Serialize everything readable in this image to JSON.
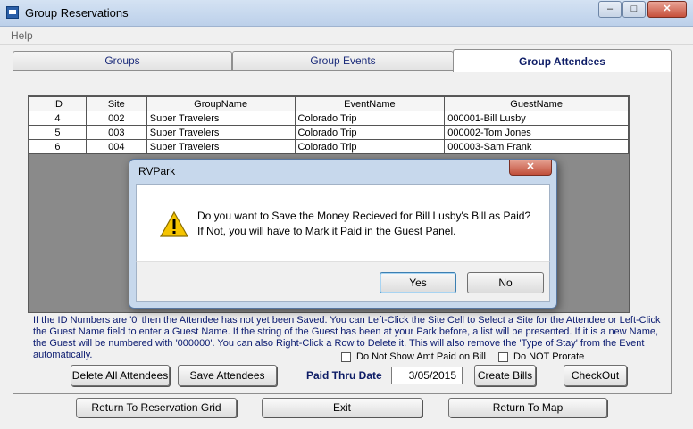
{
  "window": {
    "title": "Group Reservations",
    "minimize": "–",
    "maximize": "□",
    "close": "✕"
  },
  "menu": {
    "help": "Help"
  },
  "tabs": [
    {
      "label": "Groups"
    },
    {
      "label": "Group Events"
    },
    {
      "label": "Group Attendees"
    }
  ],
  "grid": {
    "columns": [
      "ID",
      "Site",
      "GroupName",
      "EventName",
      "GuestName"
    ],
    "rows": [
      [
        "4",
        "002",
        "Super Travelers",
        "Colorado Trip",
        "000001-Bill Lusby"
      ],
      [
        "5",
        "003",
        "Super Travelers",
        "Colorado Trip",
        "000002-Tom Jones"
      ],
      [
        "6",
        "004",
        "Super Travelers",
        "Colorado Trip",
        "000003-Sam Frank"
      ]
    ]
  },
  "dialog": {
    "title": "RVPark",
    "close": "✕",
    "line1": "Do you want to Save the Money Recieved for Bill Lusby's Bill as Paid?",
    "line2": "If Not, you will have to Mark it Paid in the Guest Panel.",
    "yes": "Yes",
    "no": "No"
  },
  "help_text": "If the ID Numbers are '0' then the Attendee has not yet been Saved. You can Left-Click the Site Cell to Select a Site for the Attendee or Left-Click the Guest Name field to enter a Guest Name.  If the string of the Guest has been at your Park before, a list will be presented.  If it is a new Name, the Guest will be numbered with '000000'.  You can also Right-Click a Row to Delete it.  This will also remove the 'Type of Stay' from the Event automatically.",
  "options": {
    "show_amt_paid": "Do Not Show Amt Paid on Bill",
    "prorate": "Do NOT Prorate"
  },
  "actions": {
    "delete_all": "Delete All Attendees",
    "save_attendees": "Save Attendees",
    "paid_thru_label": "Paid Thru Date",
    "paid_thru_value": "3/05/2015",
    "create_bills": "Create Bills",
    "checkout": "CheckOut",
    "return_grid": "Return To Reservation Grid",
    "exit": "Exit",
    "return_map": "Return To Map"
  }
}
